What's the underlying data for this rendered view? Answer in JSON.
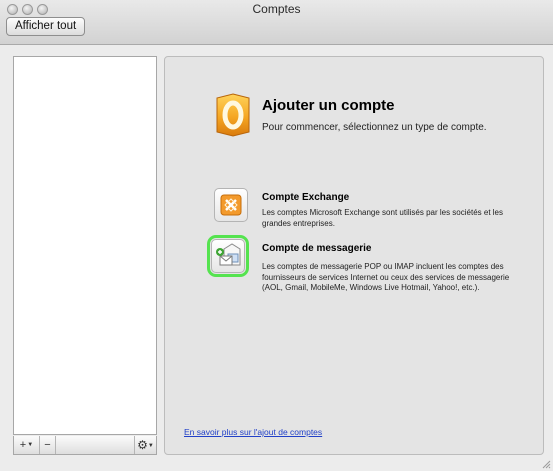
{
  "window": {
    "title": "Comptes"
  },
  "toolbar": {
    "show_all_label": "Afficher tout"
  },
  "account_list": {
    "add_label": "+",
    "remove_label": "−",
    "gear_label": "⚙"
  },
  "main": {
    "heading": "Ajouter un compte",
    "subheading": "Pour commencer, sélectionnez un type de compte.",
    "options": [
      {
        "icon": "exchange-icon",
        "title": "Compte Exchange",
        "description": "Les comptes Microsoft Exchange sont utilisés par les sociétés et les grandes entreprises."
      },
      {
        "icon": "mail-account-icon",
        "title": "Compte de messagerie",
        "description": "Les comptes de messagerie POP ou IMAP incluent les comptes des fournisseurs de services Internet ou ceux des services de messagerie (AOL, Gmail, MobileMe, Windows Live Hotmail, Yahoo!, etc.).",
        "highlight_color": "#55e34f"
      }
    ],
    "learn_more_link": "En savoir plus sur l'ajout de comptes"
  },
  "colors": {
    "link": "#2140c8",
    "outlook_orange": "#f5a623"
  }
}
